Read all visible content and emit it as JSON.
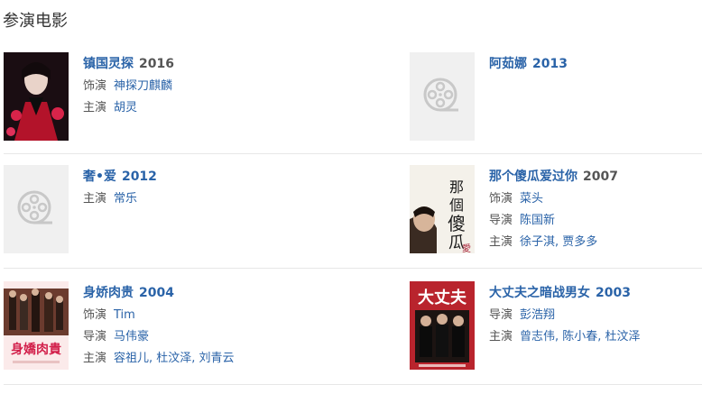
{
  "section": {
    "title": "参演电影"
  },
  "films": [
    {
      "title": "镇国灵探",
      "year": "2016",
      "roles": [
        {
          "role": "饰演",
          "value": "神探刀麒麟"
        },
        {
          "role": "主演",
          "value": "胡灵"
        }
      ]
    },
    {
      "title": "阿茹娜",
      "year": "2013",
      "roles": []
    },
    {
      "title": "奢•爱",
      "year": "2012",
      "roles": [
        {
          "role": "主演",
          "value": "常乐"
        }
      ]
    },
    {
      "title": "那个傻瓜爱过你",
      "year": "2007",
      "roles": [
        {
          "role": "饰演",
          "value": "菜头"
        },
        {
          "role": "导演",
          "value": "陈国新"
        },
        {
          "role": "主演",
          "value": "徐子淇, 贾多多"
        }
      ]
    },
    {
      "title": "身娇肉贵",
      "year": "2004",
      "roles": [
        {
          "role": "饰演",
          "value": "Tim"
        },
        {
          "role": "导演",
          "value": "马伟豪"
        },
        {
          "role": "主演",
          "value": "容祖儿, 杜汶泽, 刘青云"
        }
      ]
    },
    {
      "title": "大丈夫之暗战男女",
      "year": "2003",
      "roles": [
        {
          "role": "导演",
          "value": "彭浩翔"
        },
        {
          "role": "主演",
          "value": "曾志伟, 陈小春, 杜汶泽"
        }
      ]
    }
  ],
  "posters": {
    "poster1_text": "",
    "poster4_text": "那個傻瓜愛",
    "poster5_text": "身嬌肉貴",
    "poster6_text": "大丈夫"
  }
}
